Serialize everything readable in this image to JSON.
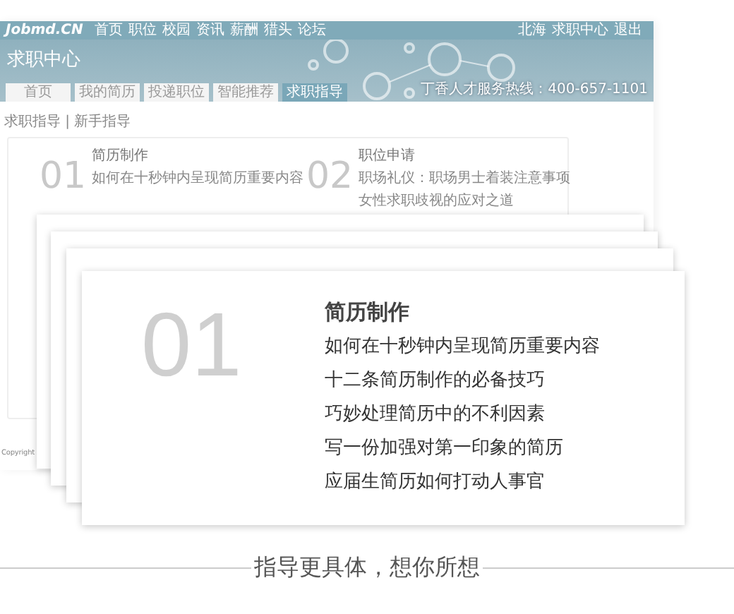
{
  "site_bar": {
    "logo": "Jobmd.CN",
    "nav": [
      "首页",
      "职位",
      "校园",
      "资讯",
      "薪酬",
      "猎头",
      "论坛"
    ],
    "user_links": [
      "北海",
      "求职中心",
      "退出"
    ]
  },
  "header": {
    "title": "求职中心",
    "hotline": "丁香人才服务热线：400-657-1101"
  },
  "tabs": [
    {
      "label": "首页",
      "selected": false
    },
    {
      "label": "我的简历",
      "selected": false
    },
    {
      "label": "投递职位",
      "selected": false
    },
    {
      "label": "智能推荐",
      "selected": false
    },
    {
      "label": "求职指导",
      "selected": true
    }
  ],
  "breadcrumb": "求职指导 | 新手指导",
  "sections": [
    {
      "number": "01",
      "title": "简历制作",
      "items": [
        "如何在十秒钟内呈现简历重要内容"
      ]
    },
    {
      "number": "02",
      "title": "职位申请",
      "items": [
        "职场礼仪：职场男士着装注意事项",
        "女性求职歧视的应对之道"
      ]
    }
  ],
  "copyright": "Copyright",
  "featured_card": {
    "number": "01",
    "title": "简历制作",
    "items": [
      "如何在十秒钟内呈现简历重要内容",
      "十二条简历制作的必备技巧",
      "巧妙处理简历中的不利因素",
      "写一份加强对第一印象的简历",
      "应届生简历如何打动人事官"
    ]
  },
  "slogan": "指导更具体，想你所想"
}
